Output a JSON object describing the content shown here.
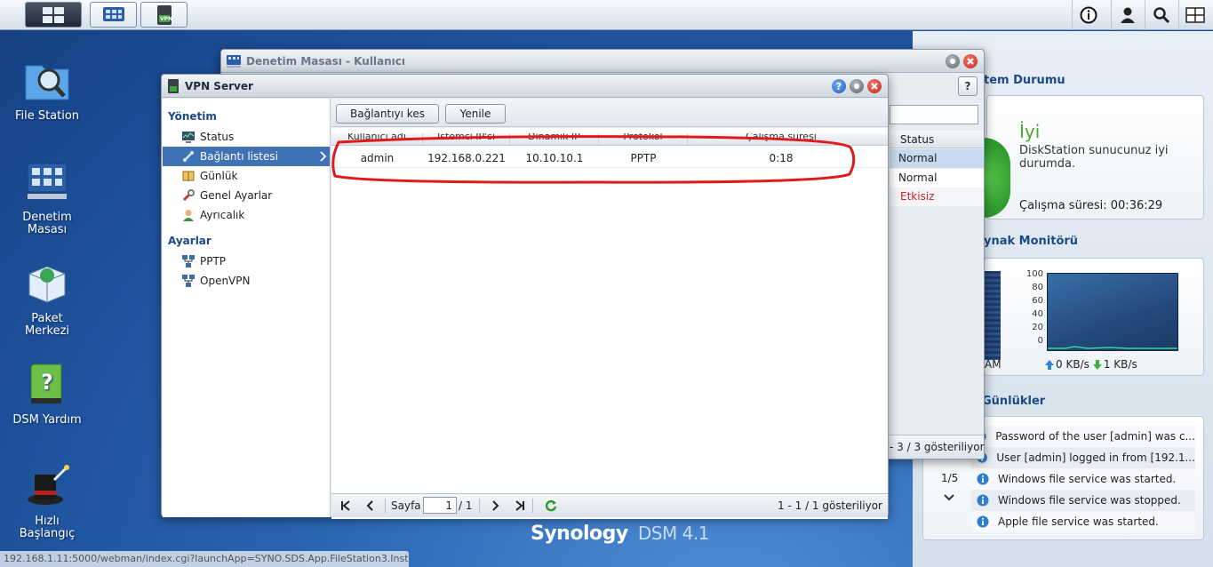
{
  "taskbar": {
    "vpn_badge": "VPN",
    "icons": [
      "home-grid-icon",
      "control-panel-icon",
      "vpn-server-icon",
      "info-icon",
      "user-icon",
      "search-icon",
      "widgets-icon"
    ]
  },
  "desktop": {
    "icons": [
      {
        "label": "File Station"
      },
      {
        "label_line1": "Denetim",
        "label_line2": "Masası"
      },
      {
        "label_line1": "Paket",
        "label_line2": "Merkezi"
      },
      {
        "label": "DSM Yardım"
      },
      {
        "label_line1": "Hızlı",
        "label_line2": "Başlangıç"
      }
    ],
    "brand": "Synology",
    "version": "DSM 4.1",
    "status_url": "192.168.1.11:5000/webman/index.cgi?launchApp=SYNO.SDS.App.FileStation3.Instance"
  },
  "control_panel": {
    "title": "Denetim Masası - Kullanıcı",
    "help": "?",
    "status_col": "Status",
    "rows": [
      "Normal",
      "Normal",
      "Etkisiz"
    ],
    "footer": "- 3 / 3 gösteriliyor"
  },
  "vpn": {
    "title": "VPN Server",
    "sidebar": {
      "group1": "Yönetim",
      "items1": [
        "Status",
        "Bağlantı listesi",
        "Günlük",
        "Genel Ayarlar",
        "Ayrıcalık"
      ],
      "group2": "Ayarlar",
      "items2": [
        "PPTP",
        "OpenVPN"
      ]
    },
    "toolbar": {
      "disconnect": "Bağlantıyı kes",
      "refresh": "Yenile"
    },
    "columns": [
      "Kullanıcı adı",
      "İstemci IP'si",
      "Dinamik IP",
      "Protokol",
      "Çalışma süresi"
    ],
    "rows": [
      {
        "user": "admin",
        "client_ip": "192.168.0.221",
        "dynamic_ip": "10.10.10.1",
        "protocol": "PPTP",
        "uptime": "0:18"
      }
    ],
    "pager": {
      "page_label": "Sayfa",
      "page_value": "1",
      "page_total": "/ 1",
      "summary": "1 - 1 / 1 gösteriliyor"
    }
  },
  "widgets": {
    "system_status": {
      "title": "tem Durumu",
      "state": "İyi",
      "desc_line1": "DiskStation sunucunuz iyi",
      "desc_line2": "durumda.",
      "uptime": "Çalışma süresi: 00:36:29"
    },
    "resource_monitor": {
      "title": "ynak Monitörü",
      "ram_label": "AM",
      "axis": [
        "100",
        "80",
        "60",
        "40",
        "20",
        "0"
      ],
      "up": "0 KB/s",
      "down": "1 KB/s"
    },
    "logs": {
      "title": "Günlükler",
      "page": "1/5",
      "items": [
        "Password of the user [admin] was c...",
        "User [admin] logged in from [192.1...",
        "Windows file service was started.",
        "Windows file service was stopped.",
        "Apple file service was started."
      ]
    }
  }
}
